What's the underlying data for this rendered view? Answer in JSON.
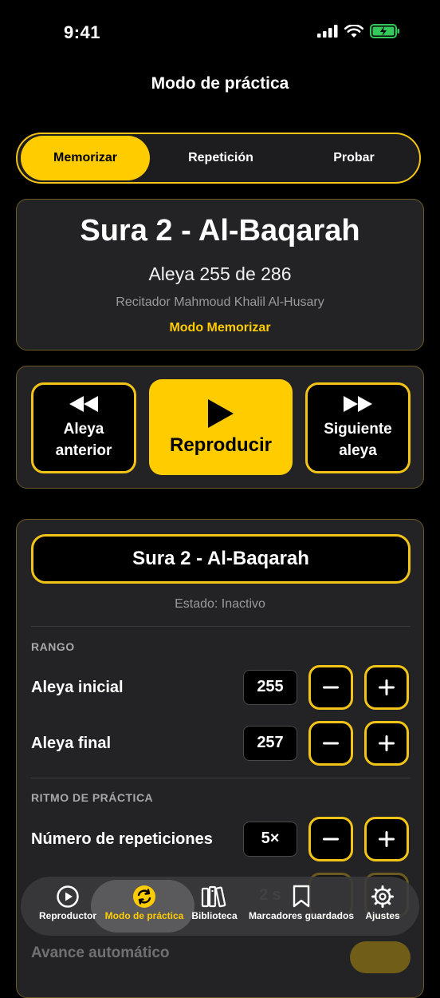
{
  "status": {
    "time": "9:41"
  },
  "nav": {
    "title": "Modo de práctica"
  },
  "segments": [
    "Memorizar",
    "Repetición",
    "Probar"
  ],
  "info": {
    "title": "Sura 2 - Al-Baqarah",
    "verse": "Aleya 255 de 286",
    "reciter": "Recitador Mahmoud Khalil Al-Husary",
    "mode": "Modo Memorizar"
  },
  "controls": {
    "prev_line1": "Aleya",
    "prev_line2": "anterior",
    "play": "Reproducir",
    "next_line1": "Siguiente",
    "next_line2": "aleya"
  },
  "settings": {
    "sura": "Sura 2 - Al-Baqarah",
    "state": "Estado: Inactivo",
    "range_label": "RANGO",
    "start_label": "Aleya inicial",
    "start_value": "255",
    "end_label": "Aleya final",
    "end_value": "257",
    "rhythm_label": "RITMO DE PRÁCTICA",
    "reps_label": "Número de repeticiones",
    "reps_value": "5×",
    "pause_value": "2 s",
    "auto_label": "Avance automático"
  },
  "tabs": [
    "Reproductor",
    "Modo de práctica",
    "Biblioteca",
    "Marcadores guardados",
    "Ajustes"
  ],
  "colors": {
    "accent": "#ffcc00",
    "background": "#000000",
    "card": "#232325"
  }
}
